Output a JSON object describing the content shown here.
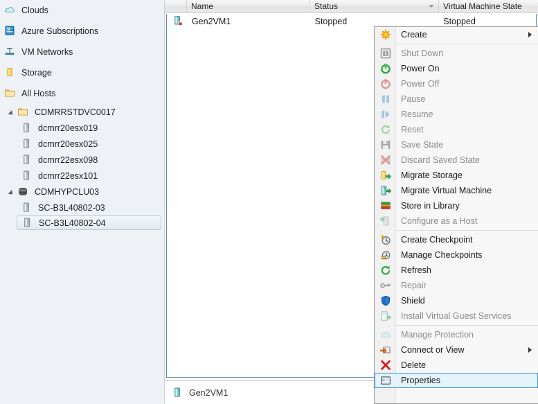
{
  "sidebar": {
    "items": [
      {
        "label": "Clouds",
        "icon": "cloud-icon",
        "level": 0,
        "expander": "none",
        "selected": false
      },
      {
        "label": "Azure Subscriptions",
        "icon": "azure-icon",
        "level": 0,
        "expander": "none",
        "selected": false
      },
      {
        "label": "VM Networks",
        "icon": "vm-network-icon",
        "level": 0,
        "expander": "none",
        "selected": false
      },
      {
        "label": "Storage",
        "icon": "storage-icon",
        "level": 0,
        "expander": "none",
        "selected": false
      },
      {
        "label": "All Hosts",
        "icon": "folder-icon",
        "level": 0,
        "expander": "none",
        "selected": false
      },
      {
        "label": "CDMRRSTDVC0017",
        "icon": "folder-icon",
        "level": 1,
        "expander": "open",
        "selected": false
      },
      {
        "label": "dcmrr20esx019",
        "icon": "host-icon",
        "level": 2,
        "expander": "none",
        "selected": false
      },
      {
        "label": "dcmrr20esx025",
        "icon": "host-icon",
        "level": 2,
        "expander": "none",
        "selected": false
      },
      {
        "label": "dcmrr22esx098",
        "icon": "host-icon",
        "level": 2,
        "expander": "none",
        "selected": false
      },
      {
        "label": "dcmrr22esx101",
        "icon": "host-icon",
        "level": 2,
        "expander": "none",
        "selected": false
      },
      {
        "label": "CDMHYPCLU03",
        "icon": "cluster-icon",
        "level": 1,
        "expander": "open",
        "selected": false
      },
      {
        "label": "SC-B3L40802-03",
        "icon": "host-icon",
        "level": 2,
        "expander": "none",
        "selected": false
      },
      {
        "label": "SC-B3L40802-04",
        "icon": "host-icon",
        "level": 2,
        "expander": "none",
        "selected": true
      }
    ]
  },
  "list": {
    "columns": [
      {
        "key": "sel",
        "label": ""
      },
      {
        "key": "name",
        "label": "Name"
      },
      {
        "key": "status",
        "label": "Status",
        "sort_indicator": true
      },
      {
        "key": "vmstate",
        "label": "Virtual Machine State"
      }
    ],
    "rows": [
      {
        "name": "Gen2VM1",
        "status": "Stopped",
        "vmstate": "Stopped",
        "icon": "vm-stopped-icon"
      }
    ]
  },
  "detail_bar": {
    "label": "Gen2VM1",
    "icon": "vm-icon"
  },
  "context_menu": {
    "items": [
      {
        "label": "Create",
        "icon": "create-star-icon",
        "enabled": true,
        "submenu": true,
        "hover": false
      },
      {
        "separator": true
      },
      {
        "label": "Shut Down",
        "icon": "shut-down-icon",
        "enabled": false,
        "submenu": false,
        "hover": false
      },
      {
        "label": "Power On",
        "icon": "power-on-icon",
        "enabled": true,
        "submenu": false,
        "hover": false
      },
      {
        "label": "Power Off",
        "icon": "power-off-icon",
        "enabled": false,
        "submenu": false,
        "hover": false
      },
      {
        "label": "Pause",
        "icon": "pause-icon",
        "enabled": false,
        "submenu": false,
        "hover": false
      },
      {
        "label": "Resume",
        "icon": "resume-icon",
        "enabled": false,
        "submenu": false,
        "hover": false
      },
      {
        "label": "Reset",
        "icon": "reset-icon",
        "enabled": false,
        "submenu": false,
        "hover": false
      },
      {
        "label": "Save State",
        "icon": "save-state-icon",
        "enabled": false,
        "submenu": false,
        "hover": false
      },
      {
        "label": "Discard Saved State",
        "icon": "discard-state-icon",
        "enabled": false,
        "submenu": false,
        "hover": false
      },
      {
        "label": "Migrate Storage",
        "icon": "migrate-storage-icon",
        "enabled": true,
        "submenu": false,
        "hover": false
      },
      {
        "label": "Migrate Virtual Machine",
        "icon": "migrate-vm-icon",
        "enabled": true,
        "submenu": false,
        "hover": false
      },
      {
        "label": "Store in Library",
        "icon": "store-library-icon",
        "enabled": true,
        "submenu": false,
        "hover": false
      },
      {
        "label": "Configure as a Host",
        "icon": "configure-host-icon",
        "enabled": false,
        "submenu": false,
        "hover": false
      },
      {
        "separator": true
      },
      {
        "label": "Create Checkpoint",
        "icon": "create-checkpoint-icon",
        "enabled": true,
        "submenu": false,
        "hover": false
      },
      {
        "label": "Manage Checkpoints",
        "icon": "manage-checkpoints-icon",
        "enabled": true,
        "submenu": false,
        "hover": false
      },
      {
        "label": "Refresh",
        "icon": "refresh-icon",
        "enabled": true,
        "submenu": false,
        "hover": false
      },
      {
        "label": "Repair",
        "icon": "repair-icon",
        "enabled": false,
        "submenu": false,
        "hover": false
      },
      {
        "label": "Shield",
        "icon": "shield-icon",
        "enabled": true,
        "submenu": false,
        "hover": false
      },
      {
        "label": "Install Virtual Guest Services",
        "icon": "install-guest-services-icon",
        "enabled": false,
        "submenu": false,
        "hover": false
      },
      {
        "separator": true
      },
      {
        "label": "Manage Protection",
        "icon": "manage-protection-icon",
        "enabled": false,
        "submenu": false,
        "hover": false
      },
      {
        "label": "Connect or View",
        "icon": "connect-view-icon",
        "enabled": true,
        "submenu": true,
        "hover": false
      },
      {
        "label": "Delete",
        "icon": "delete-icon",
        "enabled": true,
        "submenu": false,
        "hover": false
      },
      {
        "label": "Properties",
        "icon": "properties-icon",
        "enabled": true,
        "submenu": false,
        "hover": true
      }
    ]
  },
  "colors": {
    "sidebar_bg": "#eef2f6",
    "menu_bg": "#f7f7f7",
    "menu_gutter": "#f1f1f1",
    "hover_fill": "#e5f3fb",
    "hover_border": "#3c99d4",
    "disabled_text": "#8a8a8a",
    "grid_focus_border": "#5b8ab5"
  }
}
